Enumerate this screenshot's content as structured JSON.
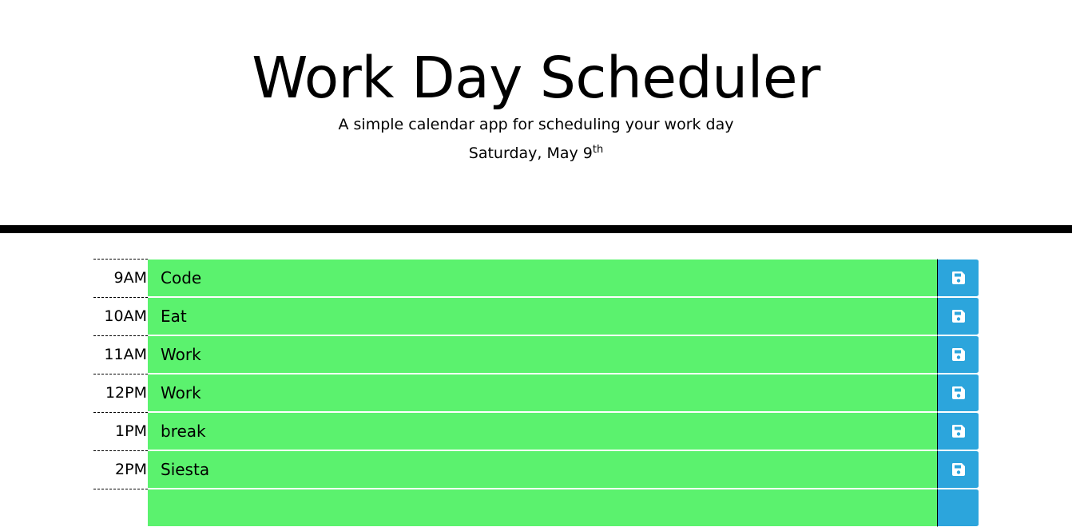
{
  "header": {
    "title": "Work Day Scheduler",
    "subtitle": "A simple calendar app for scheduling your work day",
    "current_day": "Saturday, May 9",
    "current_day_suffix": "th"
  },
  "timeblocks": [
    {
      "hour": "9AM",
      "text": "Code"
    },
    {
      "hour": "10AM",
      "text": "Eat"
    },
    {
      "hour": "11AM",
      "text": "Work"
    },
    {
      "hour": "12PM",
      "text": "Work"
    },
    {
      "hour": "1PM",
      "text": "break"
    },
    {
      "hour": "2PM",
      "text": "Siesta"
    },
    {
      "hour": "",
      "text": ""
    }
  ],
  "save_icon": "floppy-disk-icon",
  "colors": {
    "future_block": "#5bf26e",
    "save_button": "#2ca5dc",
    "divider": "#000000"
  }
}
